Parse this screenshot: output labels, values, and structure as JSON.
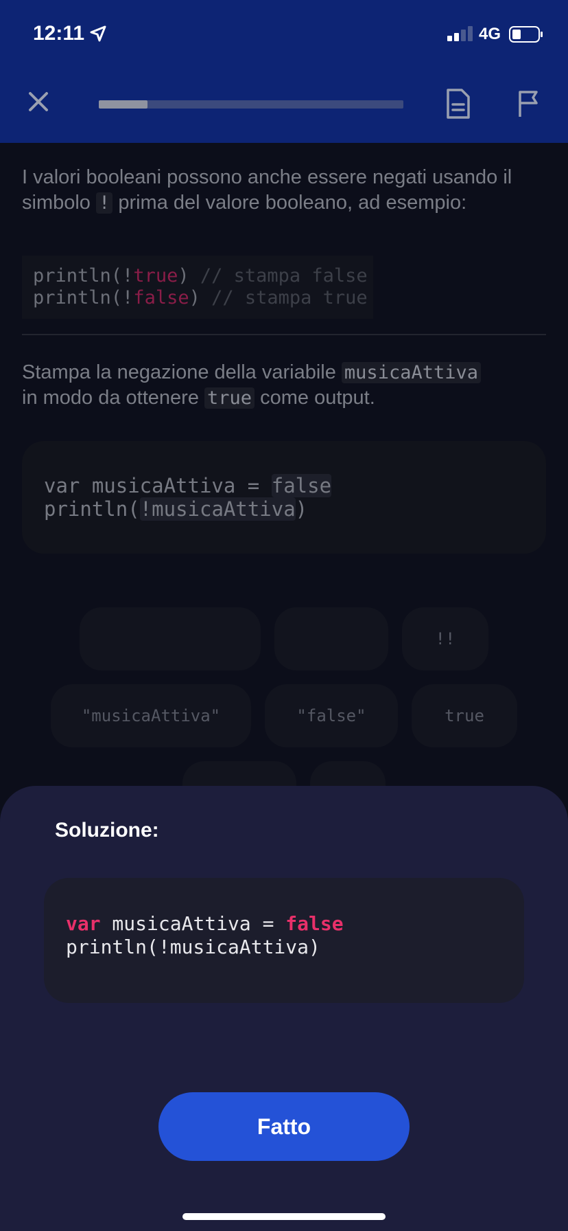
{
  "status": {
    "time": "12:11",
    "network": "4G",
    "signal_bars": 2,
    "signal_bars_total": 4,
    "battery_level": 0.3
  },
  "header": {
    "progress": 0.16
  },
  "lesson": {
    "p1_text": "I valori booleani possono anche essere negati usando il simbolo ",
    "p1_symbol": "!",
    "p1_text_after": " prima del valore booleano, ad esempio:",
    "example_code": [
      {
        "prefix": "println(!",
        "keyword": "true",
        "suffix": ") ",
        "comment": "// stampa false"
      },
      {
        "prefix": "println(!",
        "keyword": "false",
        "suffix": ") ",
        "comment": "// stampa true"
      }
    ],
    "task_text_1": "Stampa la negazione della variabile ",
    "task_var": "musicaAttiva",
    "task_text_2": "in modo da ottenere ",
    "task_value": "true",
    "task_text_3": " come output.",
    "editor": {
      "line1_prefix": "var musicaAttiva = ",
      "line1_slot": "false",
      "line2_prefix": "println(",
      "line2_slot": "!musicaAttiva",
      "line2_suffix": ")"
    }
  },
  "tokens": [
    {
      "label": ""
    },
    {
      "label": ""
    },
    {
      "label": "!!"
    },
    {
      "label": "\"musicaAttiva\""
    },
    {
      "label": "\"false\""
    },
    {
      "label": "true"
    },
    {
      "label": ""
    },
    {
      "label": ""
    }
  ],
  "solution": {
    "title": "Soluzione:",
    "line1_kw1": "var",
    "line1_mid": " musicaAttiva = ",
    "line1_kw2": "false",
    "line2": "println(!musicaAttiva)",
    "done_label": "Fatto"
  }
}
